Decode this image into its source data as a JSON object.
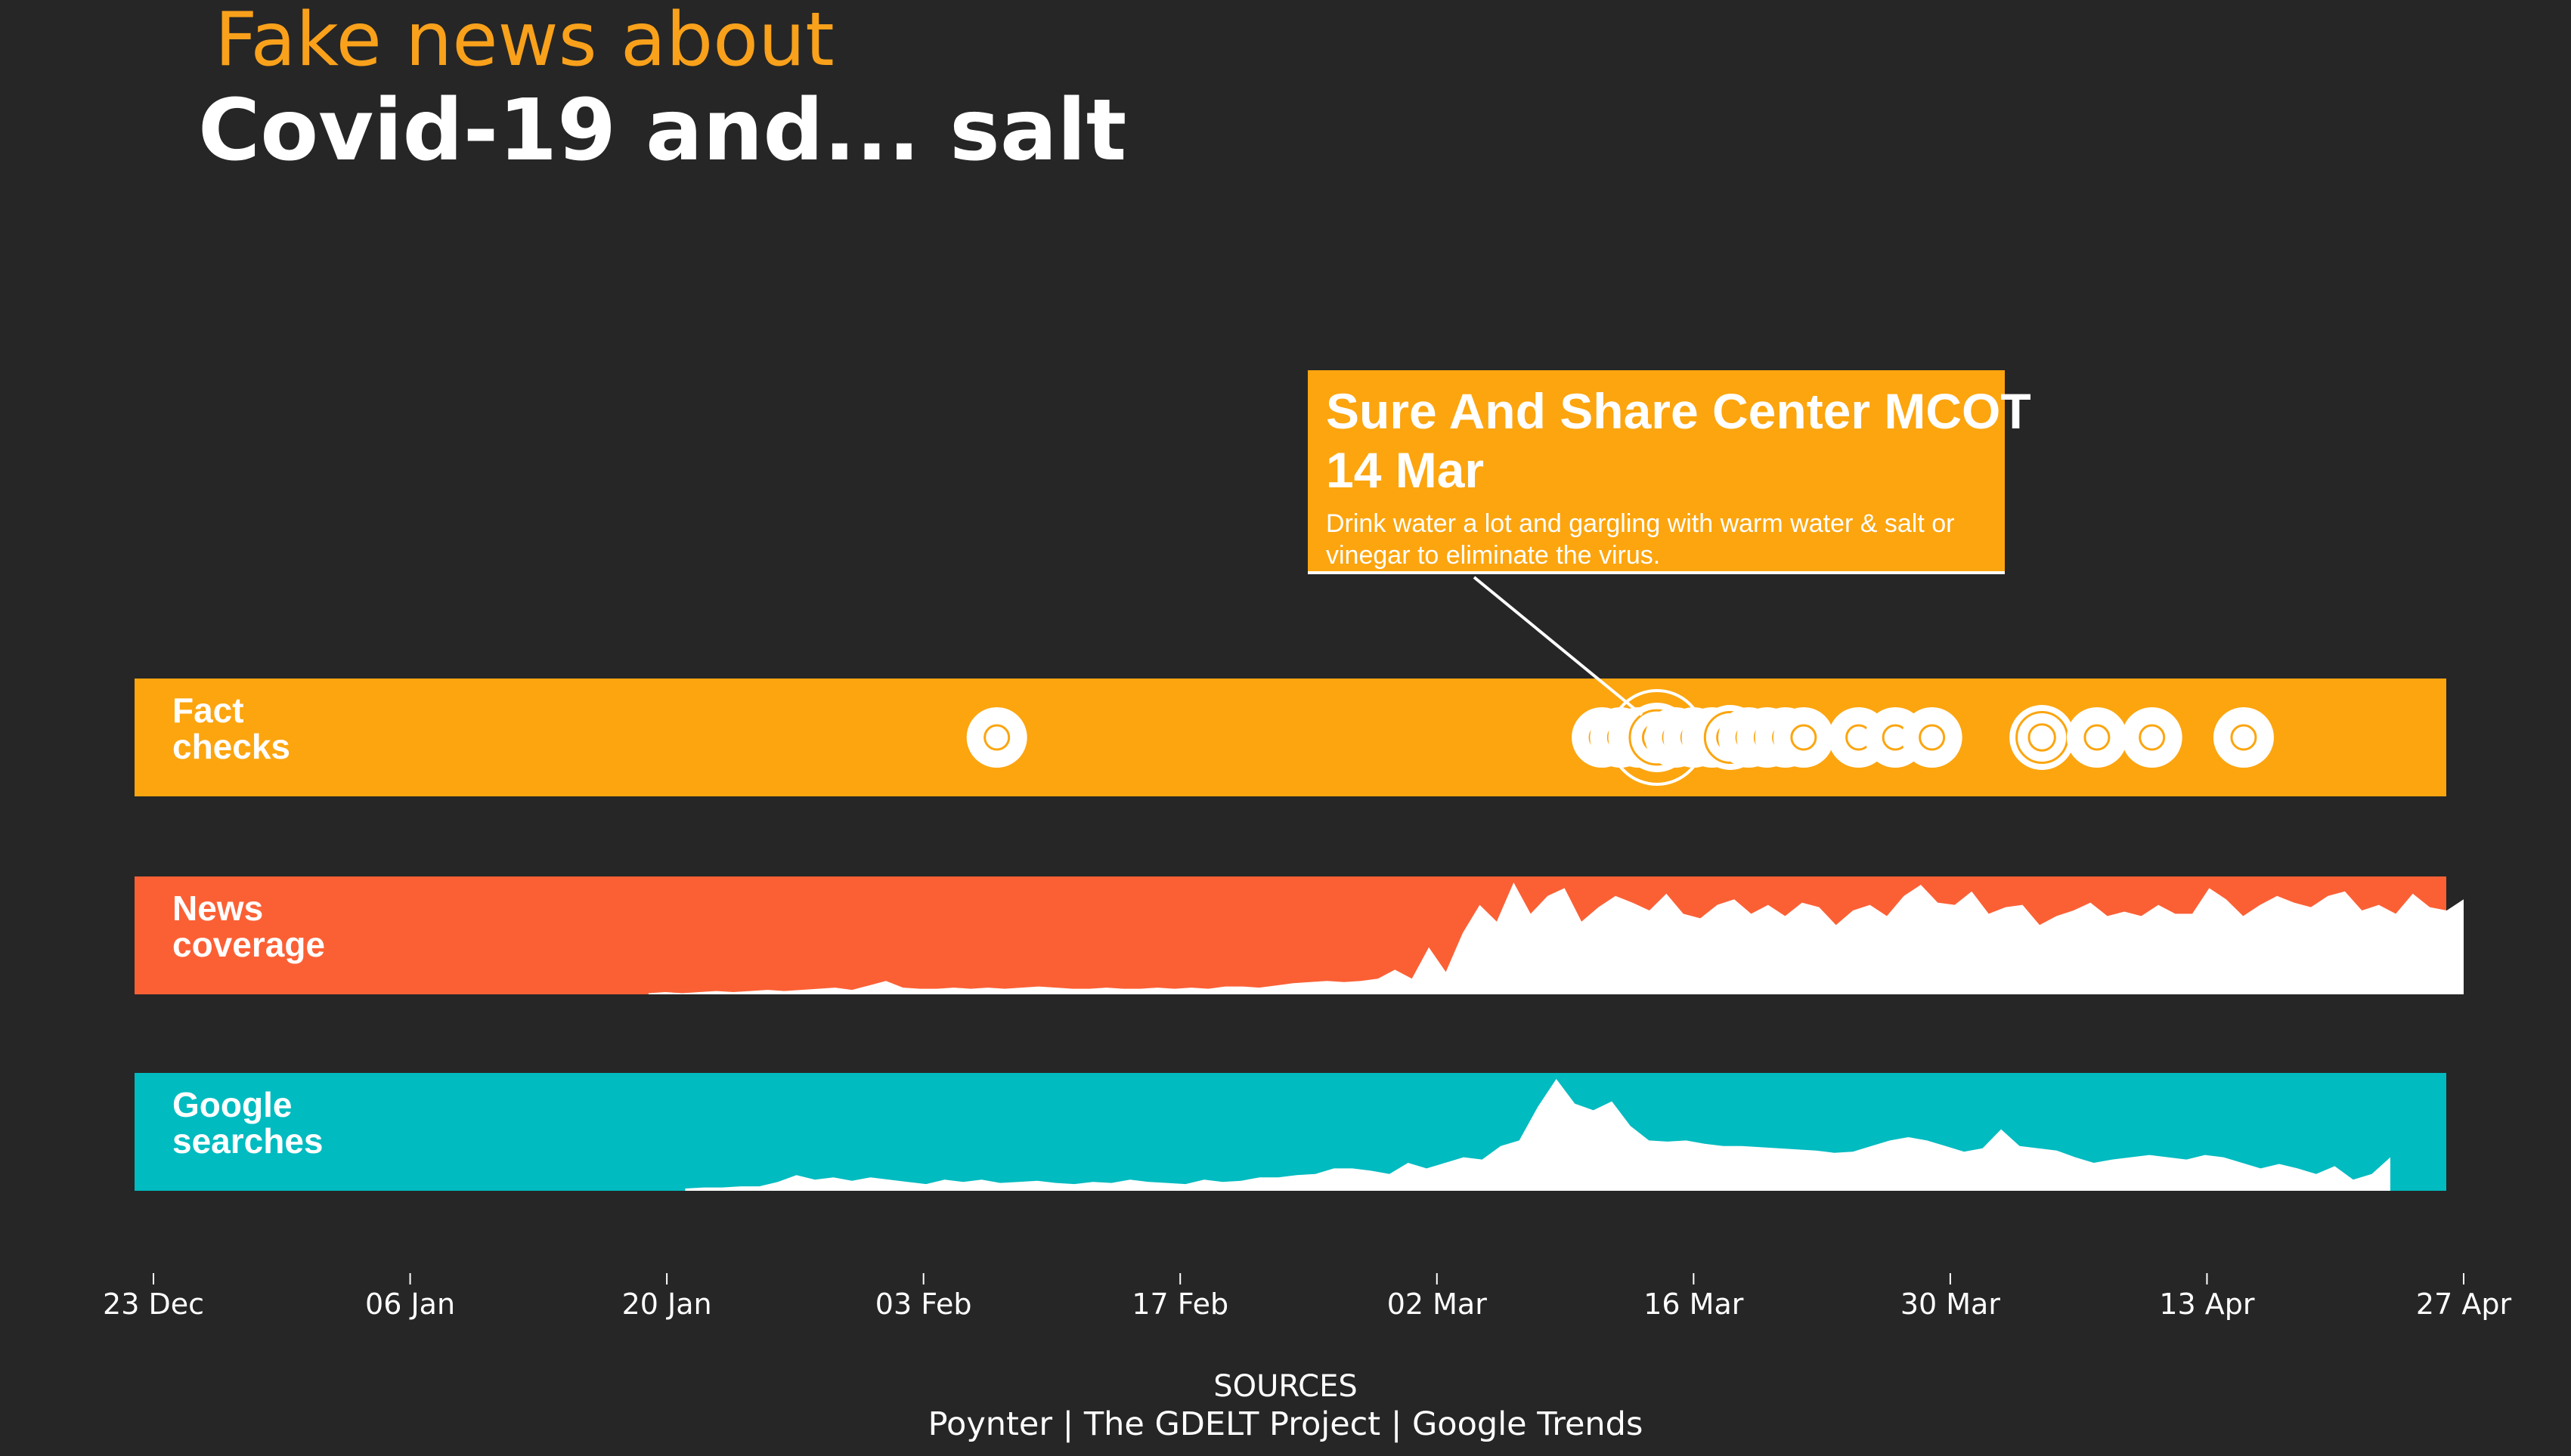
{
  "header": {
    "title_line1": "Fake news about",
    "title_line2": "Covid-19 and... salt"
  },
  "tooltip": {
    "source": "Sure And Share Center MCOT",
    "date": "14 Mar",
    "claim": "Drink water a lot and gargling with warm water & salt or vinegar to eliminate the virus."
  },
  "footer": {
    "label": "SOURCES",
    "text": "Poynter | The GDELT Project | Google Trends"
  },
  "colors": {
    "background": "#262626",
    "fact_checks": "#FCA50F",
    "news_coverage": "#FB6035",
    "google_searches": "#00BBC0",
    "title_accent": "#F9A11B",
    "fill": "#FFFFFF"
  },
  "chart_data": {
    "type": "timeline",
    "x_axis": {
      "type": "date",
      "range": [
        "2019-12-23",
        "2020-04-27"
      ],
      "ticks": [
        {
          "date": "2019-12-23",
          "label": "23 Dec"
        },
        {
          "date": "2020-01-06",
          "label": "06 Jan"
        },
        {
          "date": "2020-01-20",
          "label": "20 Jan"
        },
        {
          "date": "2020-02-03",
          "label": "03 Feb"
        },
        {
          "date": "2020-02-17",
          "label": "17 Feb"
        },
        {
          "date": "2020-03-02",
          "label": "02 Mar"
        },
        {
          "date": "2020-03-16",
          "label": "16 Mar"
        },
        {
          "date": "2020-03-30",
          "label": "30 Mar"
        },
        {
          "date": "2020-04-13",
          "label": "13 Apr"
        },
        {
          "date": "2020-04-27",
          "label": "27 Apr"
        }
      ]
    },
    "tracks": [
      {
        "name": "Fact checks",
        "label_lines": [
          "Fact",
          "checks"
        ],
        "kind": "events",
        "events": [
          {
            "date": "2020-02-07",
            "count": 1
          },
          {
            "date": "2020-03-11",
            "count": 1
          },
          {
            "date": "2020-03-12",
            "count": 1
          },
          {
            "date": "2020-03-13",
            "count": 1
          },
          {
            "date": "2020-03-14",
            "count": 3,
            "highlight": true
          },
          {
            "date": "2020-03-15",
            "count": 1
          },
          {
            "date": "2020-03-16",
            "count": 1
          },
          {
            "date": "2020-03-17",
            "count": 1
          },
          {
            "date": "2020-03-18",
            "count": 2
          },
          {
            "date": "2020-03-19",
            "count": 1
          },
          {
            "date": "2020-03-20",
            "count": 1
          },
          {
            "date": "2020-03-21",
            "count": 1
          },
          {
            "date": "2020-03-22",
            "count": 1
          },
          {
            "date": "2020-03-25",
            "count": 1
          },
          {
            "date": "2020-03-27",
            "count": 1
          },
          {
            "date": "2020-03-29",
            "count": 1
          },
          {
            "date": "2020-04-04",
            "count": 2
          },
          {
            "date": "2020-04-07",
            "count": 1
          },
          {
            "date": "2020-04-10",
            "count": 1
          },
          {
            "date": "2020-04-15",
            "count": 1
          }
        ]
      },
      {
        "name": "News coverage",
        "label_lines": [
          "News",
          "coverage"
        ],
        "kind": "area",
        "start": "2020-01-19",
        "end": "2020-04-27",
        "values": [
          1,
          2,
          1,
          2,
          3,
          2,
          3,
          4,
          3,
          4,
          5,
          6,
          4,
          8,
          12,
          6,
          5,
          5,
          6,
          5,
          6,
          5,
          6,
          7,
          6,
          5,
          5,
          6,
          5,
          5,
          6,
          5,
          6,
          5,
          7,
          7,
          6,
          8,
          10,
          11,
          12,
          11,
          12,
          14,
          22,
          14,
          42,
          20,
          55,
          80,
          65,
          100,
          72,
          88,
          95,
          65,
          78,
          88,
          82,
          75,
          90,
          72,
          68,
          80,
          85,
          72,
          80,
          70,
          82,
          78,
          62,
          75,
          80,
          70,
          88,
          98,
          82,
          80,
          92,
          72,
          78,
          80,
          62,
          70,
          75,
          82,
          70,
          74,
          70,
          80,
          72,
          72,
          95,
          85,
          70,
          80,
          88,
          82,
          78,
          88,
          92,
          75,
          80,
          72,
          90,
          78,
          75,
          85
        ]
      },
      {
        "name": "Google searches",
        "label_lines": [
          "Google",
          "searches"
        ],
        "kind": "area",
        "start": "2020-01-21",
        "end": "2020-04-23",
        "values": [
          2,
          3,
          3,
          4,
          4,
          8,
          14,
          10,
          12,
          9,
          12,
          10,
          8,
          6,
          10,
          8,
          10,
          7,
          8,
          9,
          7,
          6,
          8,
          7,
          10,
          8,
          7,
          6,
          10,
          8,
          9,
          12,
          12,
          14,
          15,
          20,
          20,
          18,
          15,
          25,
          20,
          25,
          30,
          28,
          40,
          45,
          75,
          100,
          78,
          72,
          80,
          58,
          45,
          44,
          45,
          42,
          40,
          40,
          39,
          38,
          37,
          36,
          34,
          35,
          40,
          45,
          48,
          45,
          40,
          35,
          38,
          55,
          40,
          38,
          36,
          30,
          25,
          28,
          30,
          32,
          30,
          28,
          32,
          30,
          25,
          20,
          24,
          20,
          15,
          22,
          10,
          15,
          30
        ]
      }
    ]
  }
}
